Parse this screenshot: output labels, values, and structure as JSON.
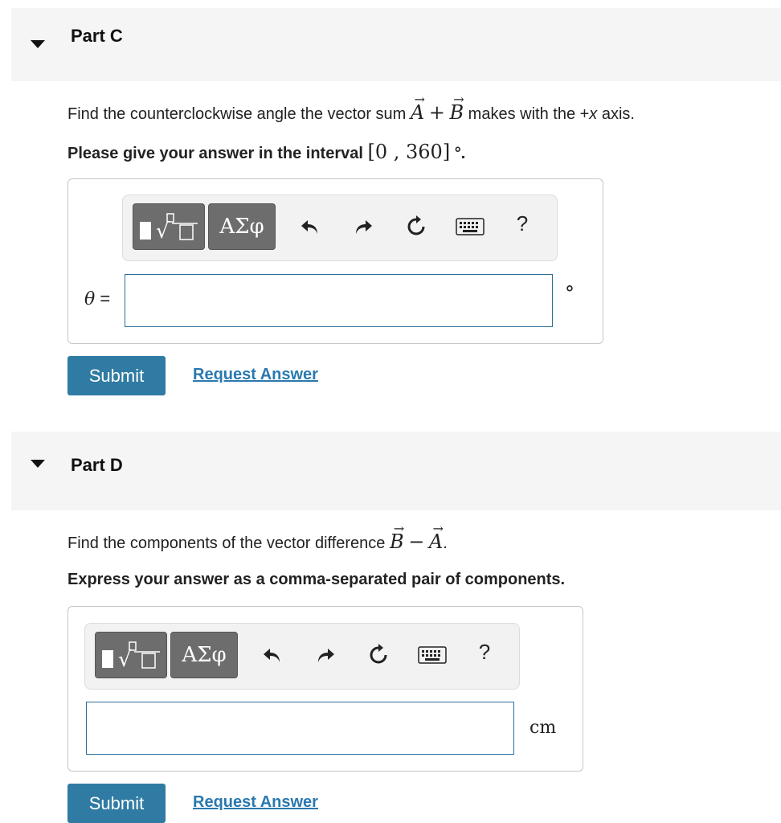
{
  "part_c": {
    "title": "Part C",
    "question_prefix": "Find the counterclockwise angle the vector sum",
    "vec_a": "A",
    "plus": "+",
    "vec_b": "B",
    "question_suffix": "makes with the +",
    "axis_var": "x",
    "question_end": "axis.",
    "instruction_prefix": "Please give your answer in the interval",
    "interval": "[0 , 360]",
    "instruction_suffix": "°.",
    "toolbar": {
      "symbols_label": "ΑΣφ",
      "help_label": "?"
    },
    "variable": "θ",
    "equals": "=",
    "input_value": "",
    "unit": "°",
    "submit_label": "Submit",
    "request_label": "Request Answer"
  },
  "part_d": {
    "title": "Part D",
    "question_prefix": "Find the components of the vector difference",
    "vec_b": "B",
    "minus": "−",
    "vec_a": "A",
    "question_end": ".",
    "instruction": "Express your answer as a comma-separated pair of components.",
    "toolbar": {
      "symbols_label": "ΑΣφ",
      "help_label": "?"
    },
    "input_value": "",
    "unit": "cm",
    "submit_label": "Submit",
    "request_label": "Request Answer"
  },
  "icons": [
    "expand-triangle-icon",
    "template-icon",
    "undo-icon",
    "redo-icon",
    "reset-icon",
    "keyboard-icon",
    "help-icon"
  ],
  "colors": {
    "button_blue": "#2f7ba3",
    "link_blue": "#2a79b0",
    "input_border": "#2c6e99",
    "header_bg": "#f5f5f5"
  }
}
